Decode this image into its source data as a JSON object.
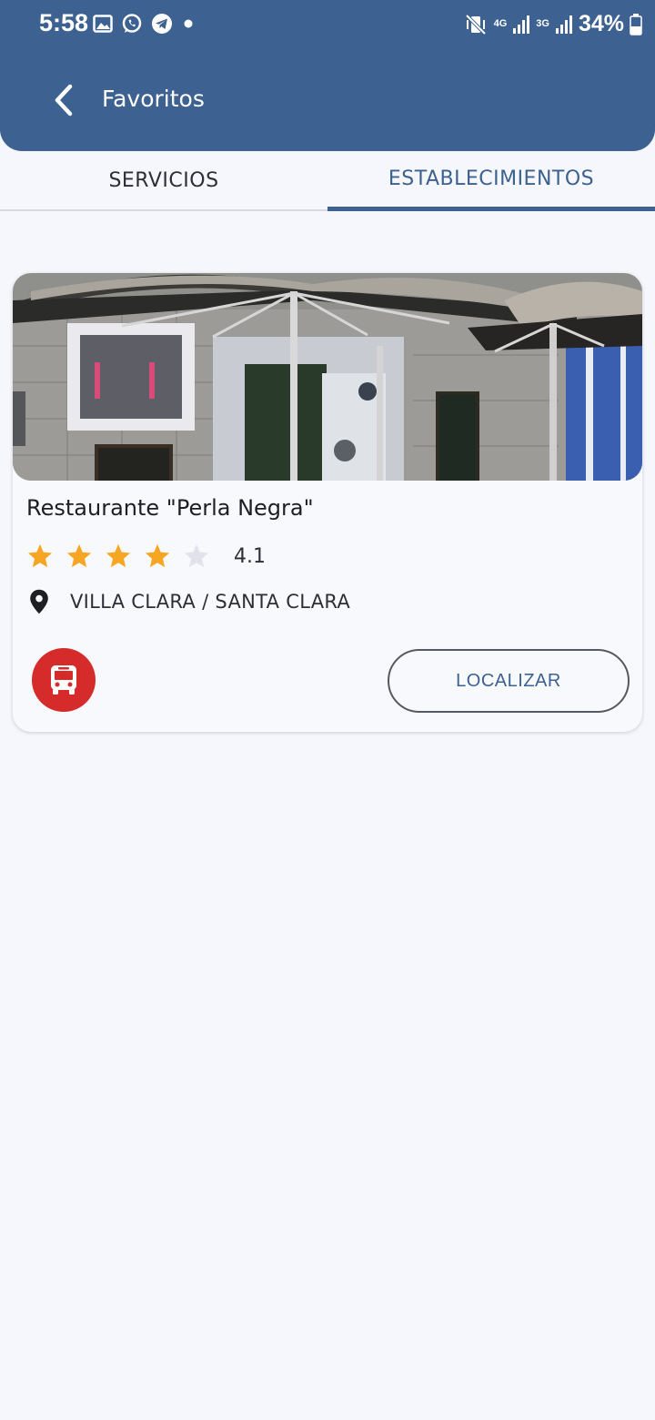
{
  "status_bar": {
    "time": "5:58",
    "net_4g": "4G",
    "net_3g": "3G",
    "battery": "34%"
  },
  "header": {
    "title": "Favoritos",
    "back_icon": "chevron-left-icon"
  },
  "tabs": [
    {
      "label": "SERVICIOS",
      "active": false
    },
    {
      "label": "ESTABLECIMIENTOS",
      "active": true
    }
  ],
  "establishment": {
    "name": "Restaurante \"Perla Negra\"",
    "rating": "4.1",
    "stars_filled": 4,
    "stars_total": 5,
    "location": "VILLA CLARA / SANTA CLARA",
    "locate_label": "LOCALIZAR",
    "transport_icon": "bus-icon"
  },
  "colors": {
    "primary": "#3d6190",
    "star": "#f6a623",
    "star_empty": "#e2e3ea",
    "bus_button": "#d52b2b",
    "background": "#f6f7fc"
  }
}
